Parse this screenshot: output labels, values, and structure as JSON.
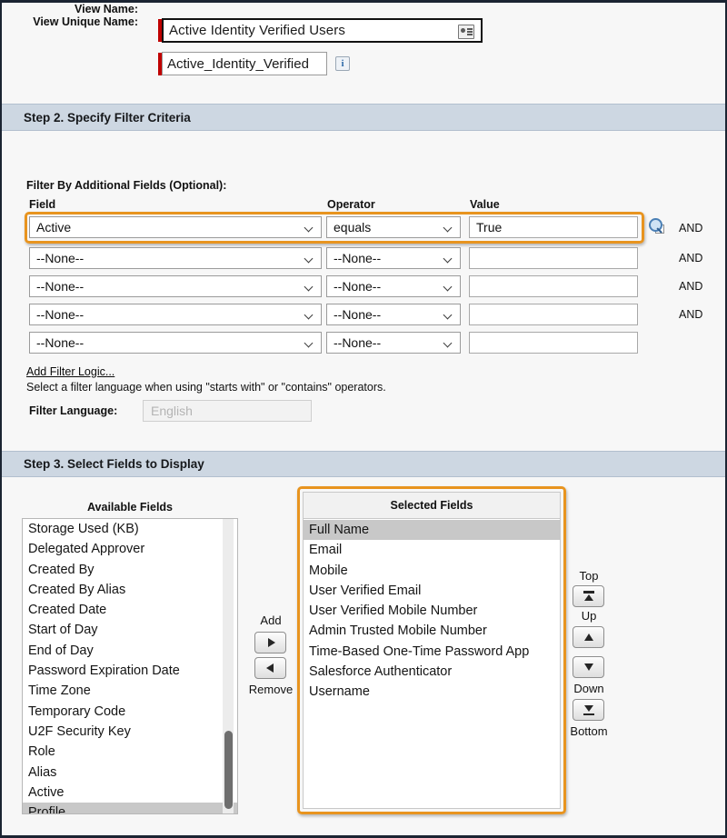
{
  "form": {
    "view_name_label": "View Name:",
    "view_name_value": "Active Identity Verified Users",
    "view_unique_name_label": "View Unique Name:",
    "view_unique_name_value": "Active_Identity_Verified",
    "info_icon_char": "i"
  },
  "step2": {
    "header": "Step 2. Specify Filter Criteria",
    "section_label": "Filter By Additional Fields (Optional):",
    "col_field": "Field",
    "col_operator": "Operator",
    "col_value": "Value",
    "rows": [
      {
        "field": "Active",
        "operator": "equals",
        "value": "True",
        "conj": "AND"
      },
      {
        "field": "--None--",
        "operator": "--None--",
        "value": "",
        "conj": "AND"
      },
      {
        "field": "--None--",
        "operator": "--None--",
        "value": "",
        "conj": "AND"
      },
      {
        "field": "--None--",
        "operator": "--None--",
        "value": "",
        "conj": "AND"
      },
      {
        "field": "--None--",
        "operator": "--None--",
        "value": "",
        "conj": ""
      }
    ],
    "add_filter_logic": "Add Filter Logic...",
    "filter_language_note": "Select a filter language when using \"starts with\" or \"contains\" operators.",
    "filter_language_label": "Filter Language:",
    "filter_language_value": "English"
  },
  "step3": {
    "header": "Step 3. Select Fields to Display",
    "available_title": "Available Fields",
    "selected_title": "Selected Fields",
    "available_fields": [
      "Storage Used (KB)",
      "Delegated Approver",
      "Created By",
      "Created By Alias",
      "Created Date",
      "Start of Day",
      "End of Day",
      "Password Expiration Date",
      "Time Zone",
      "Temporary Code",
      "U2F Security Key",
      "Role",
      "Alias",
      "Active",
      "Profile"
    ],
    "available_selected_field": "Profile",
    "selected_fields": [
      "Full Name",
      "Email",
      "Mobile",
      "User Verified Email",
      "User Verified Mobile Number",
      "Admin Trusted Mobile Number",
      "Time-Based One-Time Password App",
      "Salesforce Authenticator",
      "Username"
    ],
    "selected_highlighted_field": "Full Name",
    "add_label": "Add",
    "remove_label": "Remove",
    "top_label": "Top",
    "up_label": "Up",
    "down_label": "Down",
    "bottom_label": "Bottom"
  },
  "colors": {
    "highlight_orange": "#e8941f",
    "section_header_bg": "#cdd7e2",
    "required_red": "#c00000",
    "page_bg": "#f7f7f7"
  }
}
